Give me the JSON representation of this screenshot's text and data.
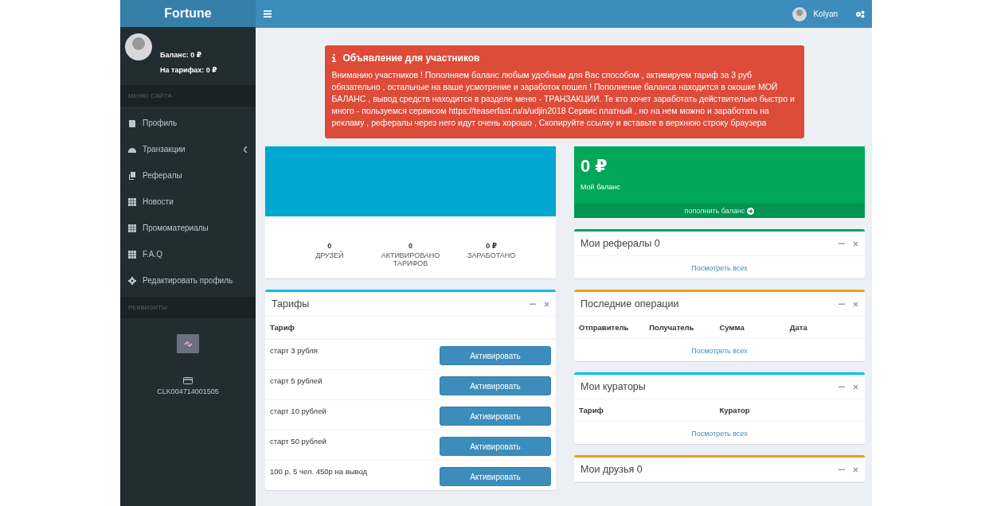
{
  "sidebar": {
    "brand": "Fortune",
    "user": {
      "balance": "Баланс: 0 ₽",
      "tariffs": "На тарифах: 0 ₽"
    },
    "menu_header": "МЕНЮ САЙТА",
    "items": [
      {
        "label": "Профиль",
        "kind": "book",
        "expandable": false
      },
      {
        "label": "Транзакции",
        "kind": "dashboard",
        "expandable": true
      },
      {
        "label": "Рефералы",
        "kind": "copy",
        "expandable": false
      },
      {
        "label": "Новости",
        "kind": "grid",
        "expandable": false
      },
      {
        "label": "Промоматериалы",
        "kind": "grid",
        "expandable": false
      },
      {
        "label": "F.A.Q",
        "kind": "grid",
        "expandable": false
      },
      {
        "label": "Редактировать профиль",
        "kind": "gear",
        "expandable": false
      }
    ],
    "requisites_header": "РЕКВИЗИТЫ",
    "requisites": [
      {
        "kind": "link"
      },
      {
        "kind": "card",
        "text": "CLK004714001505"
      }
    ]
  },
  "topbar": {
    "user": "Kolyan"
  },
  "announcement": {
    "title": "Объявление для участников",
    "text": "Вниманию участников ! Пополняем баланс любым удобным для Вас способом , активируем тариф за 3 руб обязательно , остальные на ваше усмотрение и заработок пошел ! Пополнение баланса находится в окошке МОЙ БАЛАНС , вывод средств находится в разделе меню - ТРАНЗАКЦИИ. Те кто хочет заработать действительно быстро и много - пользуемся сервисом https://teaserfast.ru/a/udjin2018 Сервис платный , но на нем можно и заработать на рекламу , рефералы через него идут очень хорошо , Скопируйте ссылку и вставьте в верхнюю строку браузера"
  },
  "profile_card": {
    "stats": [
      {
        "value": "0",
        "label": "ДРУЗЕЙ"
      },
      {
        "value": "0",
        "label": "АКТИВИРОВАНО ТАРИФОВ"
      },
      {
        "value": "0 ₽",
        "label": "ЗАРАБОТАНО"
      }
    ]
  },
  "tariffs": {
    "title": "Тарифы",
    "column": "Тариф",
    "rows": [
      {
        "name": "старт 3 рубля",
        "button": "Активировать"
      },
      {
        "name": "старт 5 рублей",
        "button": "Активировать"
      },
      {
        "name": "старт 10 рублей",
        "button": "Активировать"
      },
      {
        "name": "старт 50 рублей",
        "button": "Активировать"
      },
      {
        "name": "100 р. 5 чел. 450р на вывод",
        "button": "Активировать"
      }
    ]
  },
  "balance_card": {
    "amount": "0 ₽",
    "label": "Мой баланс",
    "link": "пополнить баланс"
  },
  "boxes": [
    {
      "title": "Мои рефералы 0",
      "color": "#00a65a",
      "link": "Посмотреть всех"
    },
    {
      "title": "Последние операции",
      "color": "#f39c12",
      "columns": [
        "Отправитель",
        "Получатель",
        "Сумма",
        "Дата"
      ],
      "link": "Посмотреть всех"
    },
    {
      "title": "Мои кураторы",
      "color": "#00c0ef",
      "columns": [
        "Тариф",
        "Куратор"
      ],
      "link": "Посмотреть всех"
    },
    {
      "title": "Мои друзья 0",
      "color": "#f39c12"
    }
  ]
}
